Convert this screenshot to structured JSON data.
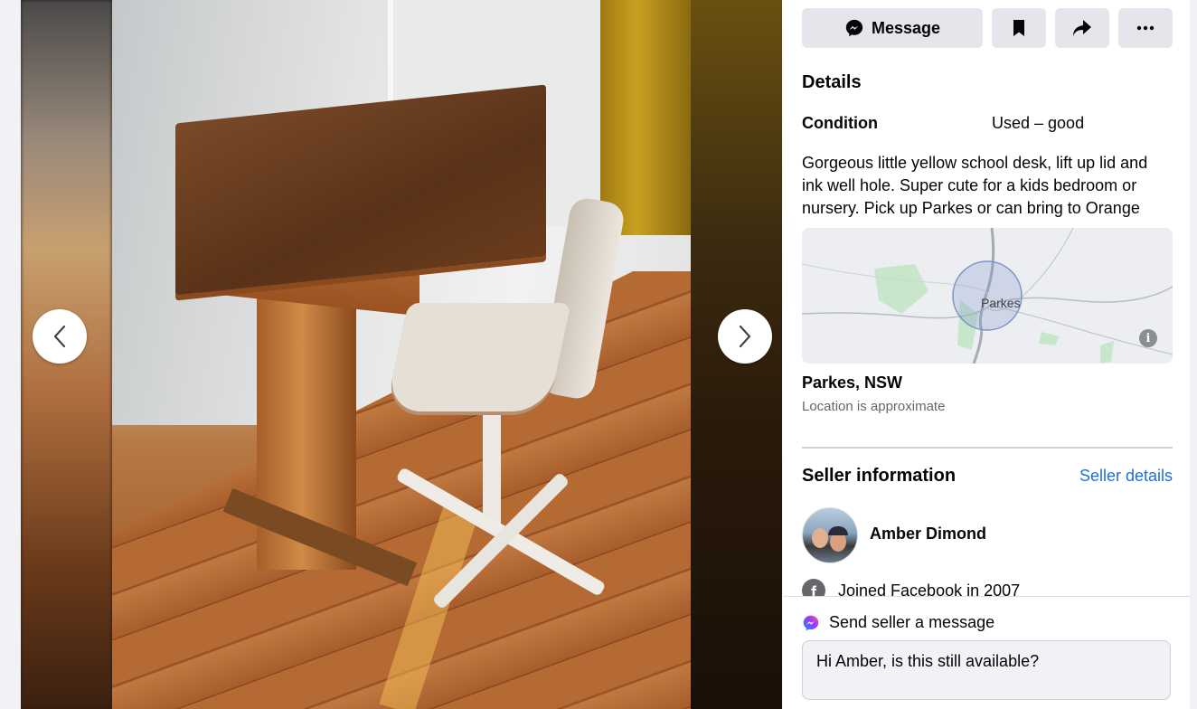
{
  "listing": {
    "actions": {
      "message_label": "Message"
    },
    "details_heading": "Details",
    "condition_label": "Condition",
    "condition_value": "Used – good",
    "description": "Gorgeous little yellow school desk, lift up lid and ink well hole. Super cute for a kids bedroom or nursery. Pick up Parkes or can bring to Orange",
    "map_label": "Parkes",
    "location": "Parkes, NSW",
    "location_note": "Location is approximate"
  },
  "seller": {
    "heading": "Seller information",
    "details_link": "Seller details",
    "name": "Amber Dimond",
    "joined": "Joined Facebook in 2007"
  },
  "message_footer": {
    "label": "Send seller a message",
    "input_value": "Hi Amber, is this still available?"
  },
  "colors": {
    "link": "#216fdb",
    "button_bg": "#e4e6eb",
    "page_bg": "#f0f2f5"
  },
  "icons": {
    "message": "messenger-icon",
    "save": "bookmark-icon",
    "share": "share-icon",
    "more": "more-icon",
    "prev": "chevron-left-icon",
    "next": "chevron-right-icon",
    "info": "info-icon",
    "facebook": "facebook-icon",
    "messenger_color": "messenger-color-icon"
  }
}
